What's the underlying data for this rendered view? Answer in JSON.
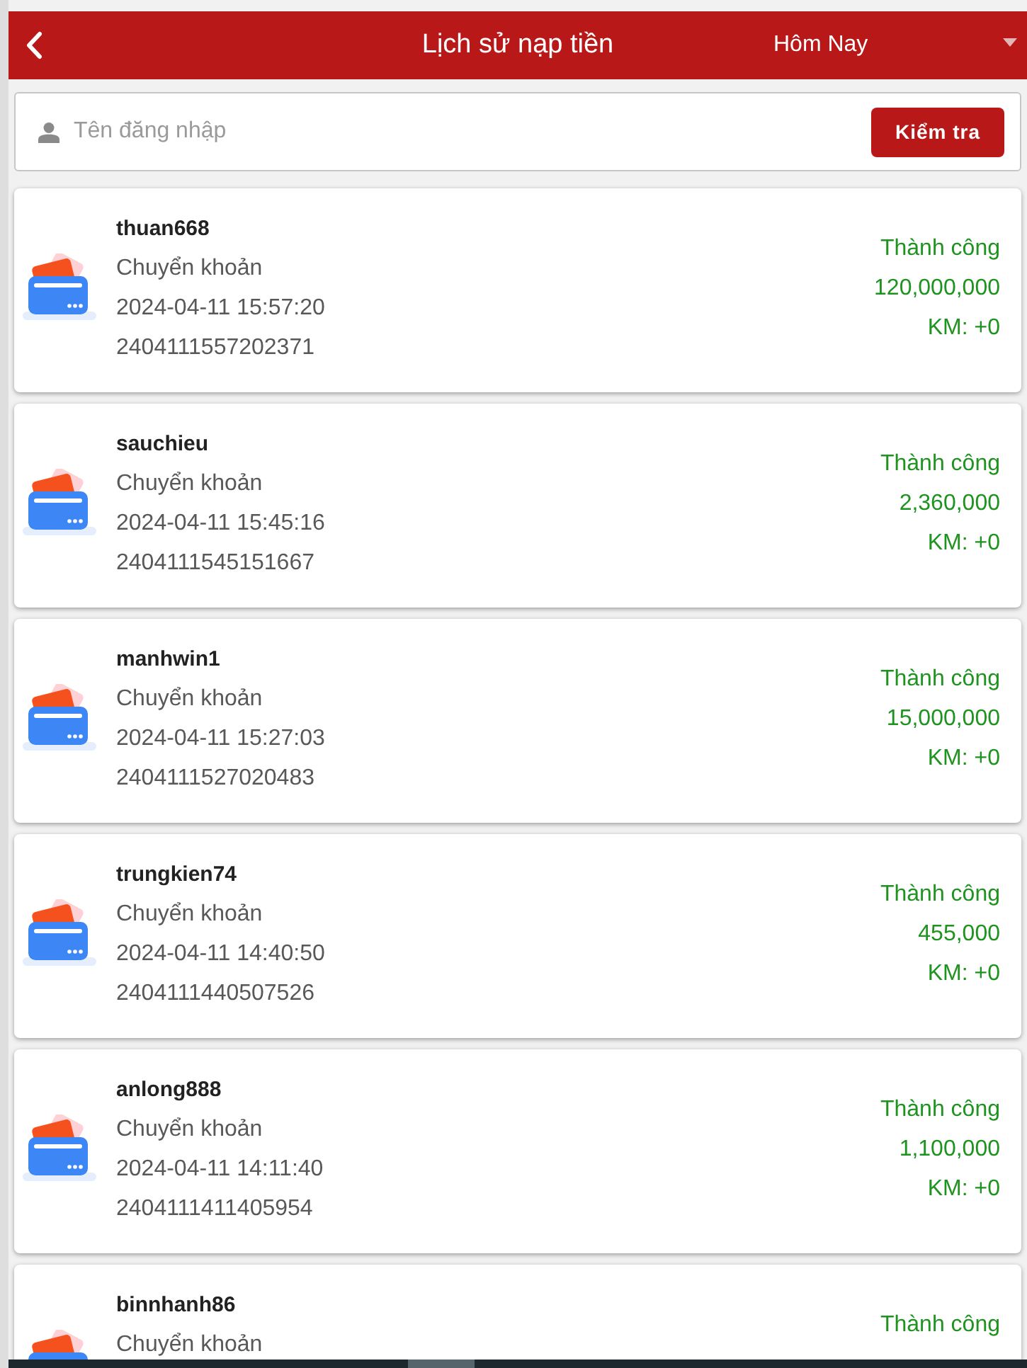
{
  "header": {
    "title": "Lịch sử nạp tiền",
    "date_filter": "Hôm Nay"
  },
  "search": {
    "placeholder": "Tên đăng nhập",
    "button": "Kiểm tra"
  },
  "transactions": [
    {
      "username": "thuan668",
      "method": "Chuyển khoản",
      "time": "2024-04-11 15:57:20",
      "order_id": "2404111557202371",
      "status": "Thành công",
      "amount": "120,000,000",
      "bonus": "KM: +0"
    },
    {
      "username": "sauchieu",
      "method": "Chuyển khoản",
      "time": "2024-04-11 15:45:16",
      "order_id": "2404111545151667",
      "status": "Thành công",
      "amount": "2,360,000",
      "bonus": "KM: +0"
    },
    {
      "username": "manhwin1",
      "method": "Chuyển khoản",
      "time": "2024-04-11 15:27:03",
      "order_id": "2404111527020483",
      "status": "Thành công",
      "amount": "15,000,000",
      "bonus": "KM: +0"
    },
    {
      "username": "trungkien74",
      "method": "Chuyển khoản",
      "time": "2024-04-11 14:40:50",
      "order_id": "2404111440507526",
      "status": "Thành công",
      "amount": "455,000",
      "bonus": "KM: +0"
    },
    {
      "username": "anlong888",
      "method": "Chuyển khoản",
      "time": "2024-04-11 14:11:40",
      "order_id": "2404111411405954",
      "status": "Thành công",
      "amount": "1,100,000",
      "bonus": "KM: +0"
    },
    {
      "username": "binnhanh86",
      "method": "Chuyển khoản",
      "status": "Thành công"
    }
  ]
}
